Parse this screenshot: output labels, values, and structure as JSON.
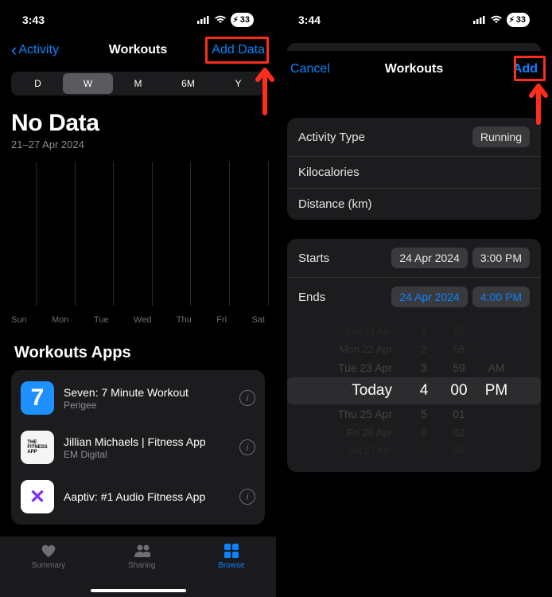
{
  "left": {
    "status": {
      "time": "3:43",
      "battery": "33"
    },
    "nav": {
      "back_label": "Activity",
      "title": "Workouts",
      "right_label": "Add Data"
    },
    "segments": [
      "D",
      "W",
      "M",
      "6M",
      "Y"
    ],
    "selected_segment": "W",
    "nodata": {
      "title": "No Data",
      "subtitle": "21–27 Apr 2024"
    },
    "xlabels": [
      "Sun",
      "Mon",
      "Tue",
      "Wed",
      "Thu",
      "Fri",
      "Sat"
    ],
    "apps_title": "Workouts Apps",
    "apps": [
      {
        "name": "Seven: 7 Minute Workout",
        "dev": "Perigee",
        "icon_text": "7",
        "bg": "#1e90ff"
      },
      {
        "name": "Jillian Michaels | Fitness App",
        "dev": "EM Digital",
        "icon_text": "THE\nFITNESS\nAPP",
        "bg": "#f5f5f5",
        "fg": "#000"
      },
      {
        "name": "Aaptiv: #1 Audio Fitness App",
        "dev": "",
        "icon_text": "✕",
        "bg": "#fff",
        "fg": "#7b2cff"
      }
    ],
    "tabs": {
      "summary": "Summary",
      "sharing": "Sharing",
      "browse": "Browse"
    }
  },
  "right": {
    "status": {
      "time": "3:44",
      "battery": "33"
    },
    "nav": {
      "cancel": "Cancel",
      "title": "Workouts",
      "add": "Add"
    },
    "form": {
      "activity_label": "Activity Type",
      "activity_value": "Running",
      "kcal_label": "Kilocalories",
      "dist_label": "Distance (km)",
      "starts_label": "Starts",
      "starts_date": "24 Apr 2024",
      "starts_time": "3:00 PM",
      "ends_label": "Ends",
      "ends_date": "24 Apr 2024",
      "ends_time": "4:00 PM"
    },
    "picker": [
      {
        "day": "Sun 21 Apr",
        "h": "1",
        "m": "57",
        "ap": "",
        "cls": "fade3"
      },
      {
        "day": "Mon 22 Apr",
        "h": "2",
        "m": "58",
        "ap": "",
        "cls": "fade2"
      },
      {
        "day": "Tue 23 Apr",
        "h": "3",
        "m": "59",
        "ap": "AM",
        "cls": "fade1"
      },
      {
        "day": "Today",
        "h": "4",
        "m": "00",
        "ap": "PM",
        "cls": "sel"
      },
      {
        "day": "Thu 25 Apr",
        "h": "5",
        "m": "01",
        "ap": "",
        "cls": "fade1"
      },
      {
        "day": "Fri 26 Apr",
        "h": "6",
        "m": "02",
        "ap": "",
        "cls": "fade2"
      },
      {
        "day": "Sat 27 Apr",
        "h": "7",
        "m": "03",
        "ap": "",
        "cls": "fade3"
      }
    ]
  }
}
